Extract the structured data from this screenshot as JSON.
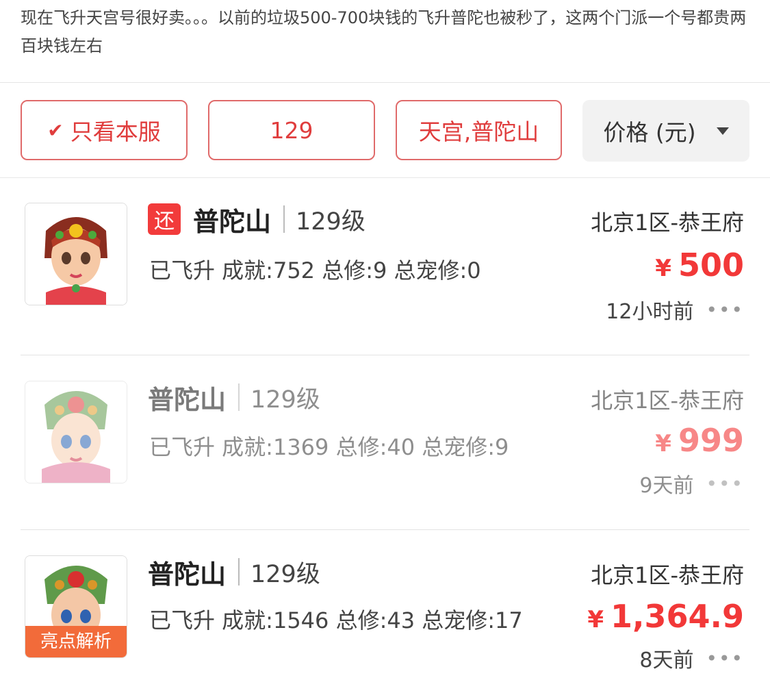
{
  "intro": "现在飞升天宫号很好卖。。。以前的垃圾500-700块钱的飞升普陀也被秒了，这两个门派一个号都贵两百块钱左右",
  "filters": {
    "only_this_server": "只看本服",
    "level": "129",
    "sects": "天宫,普陀山",
    "price_sort": "价格 (元)"
  },
  "listings": [
    {
      "badge": "还",
      "cls": "普陀山",
      "level": "129级",
      "stats": "已飞升 成就:752 总修:9 总宠修:0",
      "server": "北京1区-恭王府",
      "currency": "¥",
      "price": "500",
      "time": "12小时前"
    },
    {
      "cls": "普陀山",
      "level": "129级",
      "stats": "已飞升 成就:1369 总修:40 总宠修:9",
      "server": "北京1区-恭王府",
      "currency": "¥",
      "price": "999",
      "time": "9天前"
    },
    {
      "cls": "普陀山",
      "level": "129级",
      "stats": "已飞升 成就:1546 总修:43 总宠修:17",
      "server": "北京1区-恭王府",
      "currency": "¥",
      "price": "1,364.9",
      "time": "8天前",
      "highlight": "亮点解析"
    }
  ],
  "colors": {
    "accent": "#f23838",
    "border": "#e06a6a"
  }
}
